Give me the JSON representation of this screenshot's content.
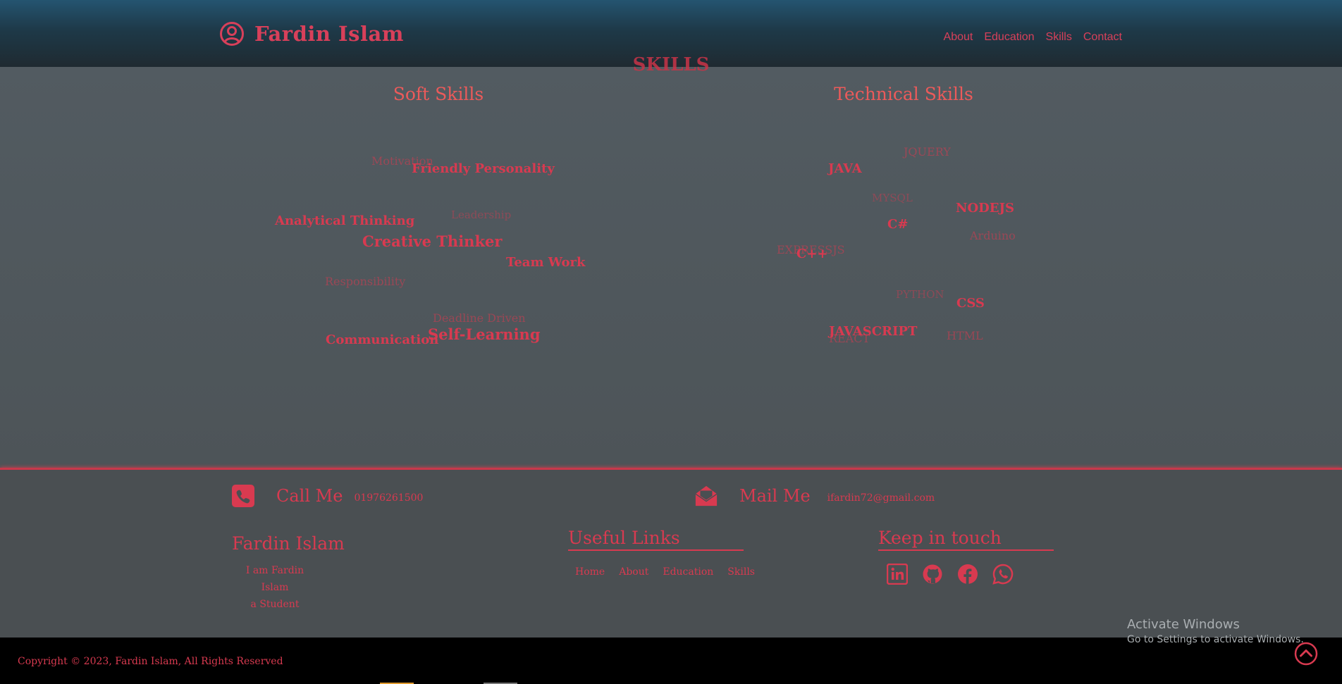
{
  "header": {
    "brand_name": "Fardin Islam",
    "nav": [
      "About",
      "Education",
      "Skills",
      "Contact"
    ]
  },
  "skills": {
    "title": "SKILLS",
    "soft_title": "Soft Skills",
    "tech_title": "Technical Skills",
    "soft": [
      "Motivation",
      "Friendly Personality",
      "Leadership",
      "Analytical Thinking",
      "Creative Thinker",
      "Team Work",
      "Responsibility",
      "Deadline Driven",
      "Self-Learning",
      "Communication"
    ],
    "technical": [
      "JQUERY",
      "JAVA",
      "MYSQL",
      "NODEJS",
      "C#",
      "Arduino",
      "EXPRESSJS",
      "C++",
      "PYTHON",
      "CSS",
      "JAVASCRIPT",
      "REACT",
      "HTML"
    ]
  },
  "contact": {
    "call_title": "Call Me",
    "call_value": "01976261500",
    "mail_title": "Mail Me",
    "mail_value": "ifardin72@gmail.com"
  },
  "footer": {
    "about_heading": "Fardin Islam",
    "about_line1": "I am Fardin Islam",
    "about_line2": "a Student",
    "links_heading": "Useful Links",
    "links": [
      "Home",
      "About",
      "Education",
      "Skills"
    ],
    "social_heading": "Keep in touch",
    "socials": [
      "linkedin-icon",
      "github-icon",
      "facebook-icon",
      "whatsapp-icon"
    ],
    "copyright": "Copyright © 2023, Fardin Islam, All Rights Reserved"
  },
  "windows_watermark": {
    "line1": "Activate Windows",
    "line2": "Go to Settings to activate Windows."
  },
  "colors": {
    "accent": "#d83a50",
    "heading_accent": "#ec5a5a",
    "header_top": "#245470",
    "body_bg": "#4b5256",
    "bottom_bar": "#000000"
  }
}
